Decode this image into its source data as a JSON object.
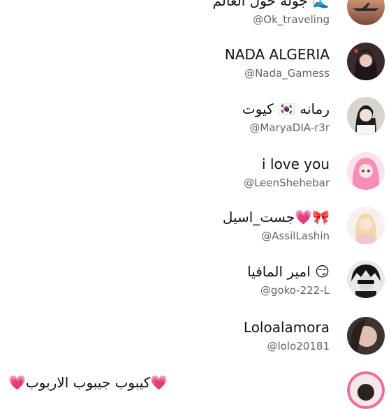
{
  "followers": [
    {
      "name": "جولة حول العالم 🌊",
      "handle": "@Ok_traveling",
      "avatar": "plane-avatar"
    },
    {
      "name": "NADA ALGERIA",
      "handle": "@Nada_Gamess",
      "avatar": "girl-dark-hair-avatar"
    },
    {
      "name": "كيوت 🇰🇷 رمانه",
      "handle": "@MaryaDIA-r3r",
      "avatar": "girl-peace-sign-avatar"
    },
    {
      "name": "i love you",
      "handle": "@LeenShehebar",
      "avatar": "pink-hair-anime-avatar"
    },
    {
      "name": "جست_اسيل💗🎀",
      "handle": "@AssilLashin",
      "avatar": "blonde-doll-avatar"
    },
    {
      "name": "امير المافيا 😏",
      "handle": "@goko-222-L",
      "avatar": "anime-sunglasses-avatar"
    },
    {
      "name": "Loloalamora",
      "handle": "@lolo20181",
      "avatar": "girl-face-avatar"
    }
  ],
  "partial_follower": {
    "name": "💗كيبوب جيبوب الاربوب💗",
    "avatar": "pink-frame-avatar"
  }
}
